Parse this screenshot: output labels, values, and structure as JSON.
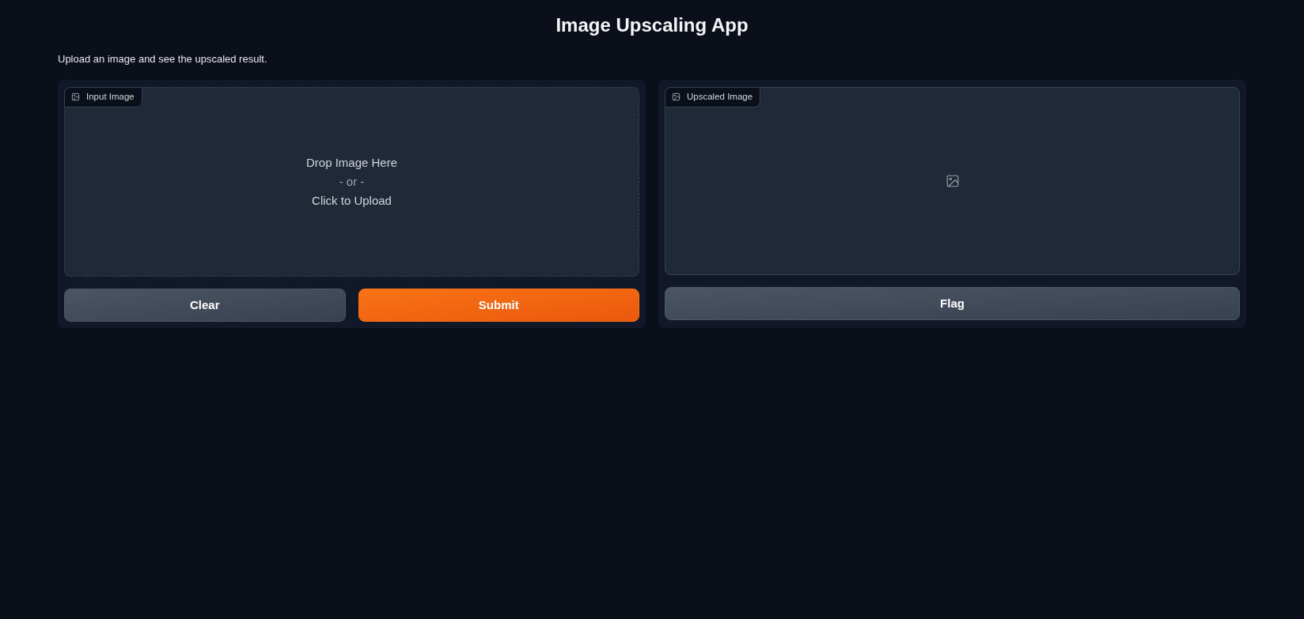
{
  "title": "Image Upscaling App",
  "description": "Upload an image and see the upscaled result.",
  "panels": [
    {
      "image_label": "Input Image",
      "kind": "upload",
      "drop_lines": [
        {
          "text": "Drop Image Here",
          "kind": "main"
        },
        {
          "text": "- or -",
          "kind": "muted"
        },
        {
          "text": "Click to Upload",
          "kind": "main"
        }
      ],
      "buttons": [
        {
          "label": "Clear",
          "kind": "secondary"
        },
        {
          "label": "Submit",
          "kind": "primary"
        }
      ]
    },
    {
      "image_label": "Upscaled Image",
      "kind": "output",
      "buttons": [
        {
          "label": "Flag",
          "kind": "secondary"
        }
      ]
    }
  ]
}
